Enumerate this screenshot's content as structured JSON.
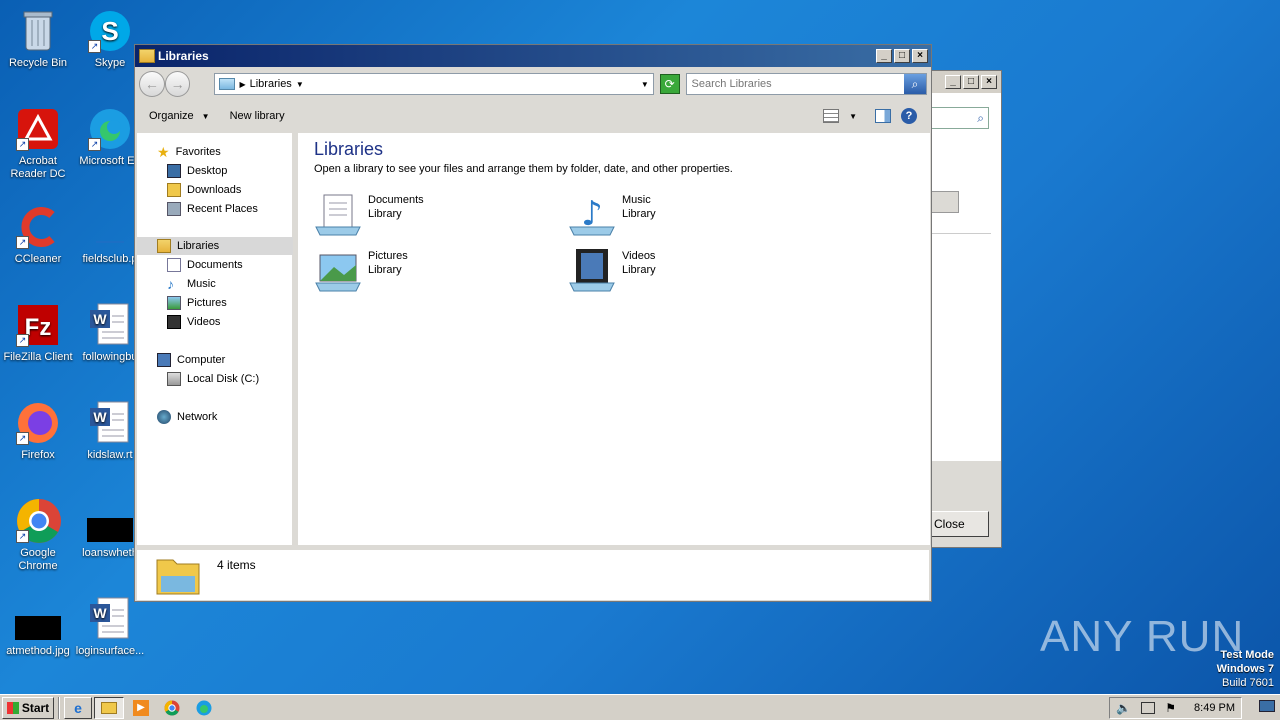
{
  "desktop": {
    "icons": [
      {
        "label": "Recycle Bin"
      },
      {
        "label": "Skype"
      },
      {
        "label": "Acrobat Reader DC"
      },
      {
        "label": "Microsoft Ed"
      },
      {
        "label": "CCleaner"
      },
      {
        "label": "fieldsclub.p"
      },
      {
        "label": "FileZilla Client"
      },
      {
        "label": "followingbu"
      },
      {
        "label": "Firefox"
      },
      {
        "label": "kidslaw.rt"
      },
      {
        "label": "Google Chrome"
      },
      {
        "label": "loanswheth"
      },
      {
        "label": "atmethod.jpg"
      },
      {
        "label": "loginsurface..."
      }
    ],
    "watermark": "ANY RUN",
    "os_info": {
      "line1": "Test Mode",
      "line2": "Windows 7",
      "line3": "Build 7601"
    }
  },
  "back_window": {
    "close_label": "Close"
  },
  "window": {
    "title": "Libraries",
    "address": {
      "crumb": "Libraries"
    },
    "search": {
      "placeholder": "Search Libraries"
    },
    "toolbar": {
      "organize": "Organize",
      "new_library": "New library"
    },
    "nav": {
      "favorites": "Favorites",
      "desktop": "Desktop",
      "downloads": "Downloads",
      "recent": "Recent Places",
      "libraries": "Libraries",
      "documents": "Documents",
      "music": "Music",
      "pictures": "Pictures",
      "videos": "Videos",
      "computer": "Computer",
      "local_disk": "Local Disk (C:)",
      "network": "Network"
    },
    "content": {
      "heading": "Libraries",
      "description": "Open a library to see your files and arrange them by folder, date, and other properties.",
      "items": [
        {
          "name": "Documents",
          "type": "Library"
        },
        {
          "name": "Music",
          "type": "Library"
        },
        {
          "name": "Pictures",
          "type": "Library"
        },
        {
          "name": "Videos",
          "type": "Library"
        }
      ]
    },
    "details": {
      "count": "4 items"
    }
  },
  "taskbar": {
    "start": "Start",
    "clock": "8:49 PM"
  }
}
